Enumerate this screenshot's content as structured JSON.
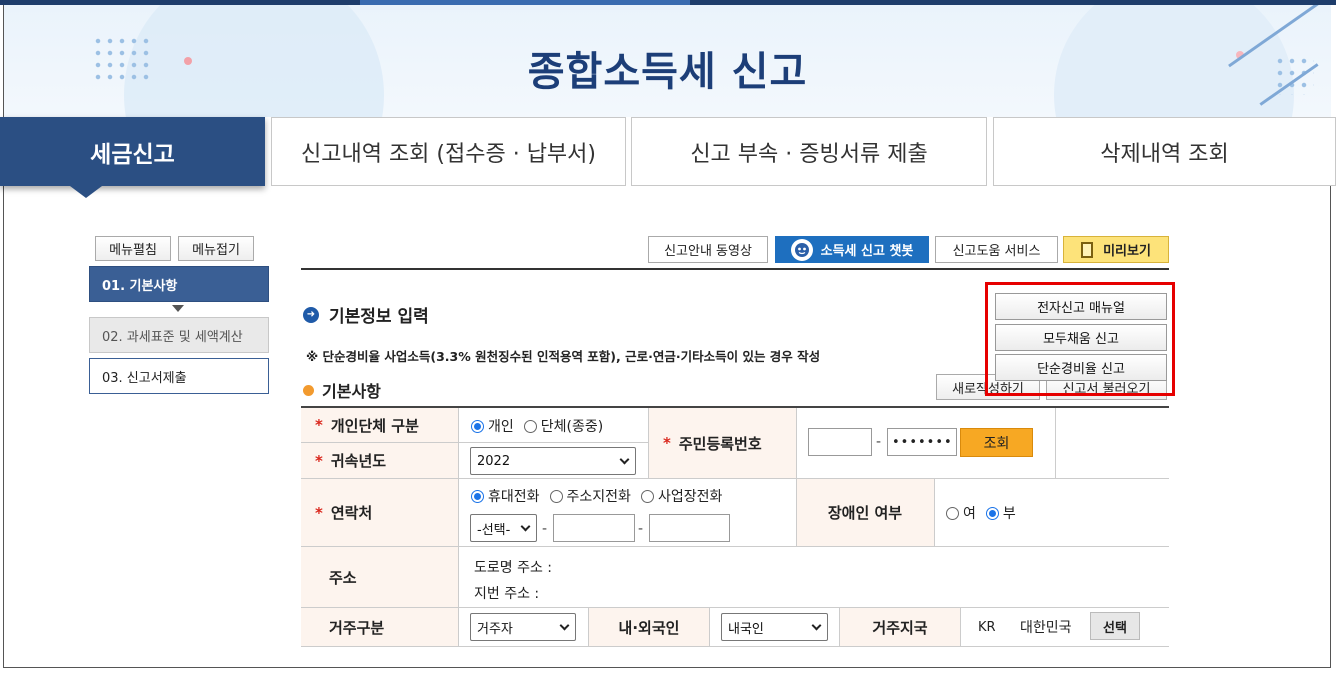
{
  "header": {
    "title": "종합소득세 신고"
  },
  "tabs": [
    {
      "label": "세금신고",
      "active": true
    },
    {
      "label": "신고내역 조회 (접수증 · 납부서)"
    },
    {
      "label": "신고 부속 · 증빙서류 제출"
    },
    {
      "label": "삭제내역 조회"
    }
  ],
  "sidebar": {
    "expand_label": "메뉴펼침",
    "collapse_label": "메뉴접기",
    "items": [
      {
        "label": "01. 기본사항",
        "state": "active"
      },
      {
        "label": "02. 과세표준 및 세액계산",
        "state": "disabled"
      },
      {
        "label": "03. 신고서제출",
        "state": "normal"
      }
    ]
  },
  "toolbar": {
    "video_label": "신고안내 동영상",
    "chatbot_label": "소득세 신고 챗봇",
    "help_label": "신고도움 서비스",
    "preview_label": "미리보기"
  },
  "section": {
    "title": "기본정보 입력",
    "note": "※ 단순경비율 사업소득(3.3% 원천징수된 인적용역 포함), 근로·연금·기타소득이 있는 경우 작성",
    "subtitle": "기본사항",
    "new_label": "새로작성하기",
    "load_label": "신고서 불러오기"
  },
  "popup_menu": {
    "items": [
      "전자신고 매뉴얼",
      "모두채움 신고",
      "단순경비율 신고"
    ],
    "highlight_color": "#e60000"
  },
  "form": {
    "type_label": "개인단체 구분",
    "type_options": [
      "개인",
      "단체(종중)"
    ],
    "type_selected": "개인",
    "year_label": "귀속년도",
    "year_value": "2022",
    "rrn_label": "주민등록번호",
    "rrn_first": "",
    "rrn_second": "•••••••",
    "rrn_button": "조회",
    "dash": "-",
    "contact_label": "연락처",
    "contact_options": [
      "휴대전화",
      "주소지전화",
      "사업장전화"
    ],
    "contact_selected": "휴대전화",
    "contact_select": "-선택-",
    "disabled_label": "장애인 여부",
    "disabled_options": [
      "여",
      "부"
    ],
    "disabled_selected": "부",
    "address_label": "주소",
    "road_address": "도로명 주소 :",
    "lot_address": "지번 주소 :",
    "residence_label": "거주구분",
    "residence_value": "거주자",
    "nationality_label": "내·외국인",
    "nationality_value": "내국인",
    "country_label": "거주지국",
    "country_code": "KR",
    "country_name": "대한민국",
    "select_button": "선택"
  }
}
